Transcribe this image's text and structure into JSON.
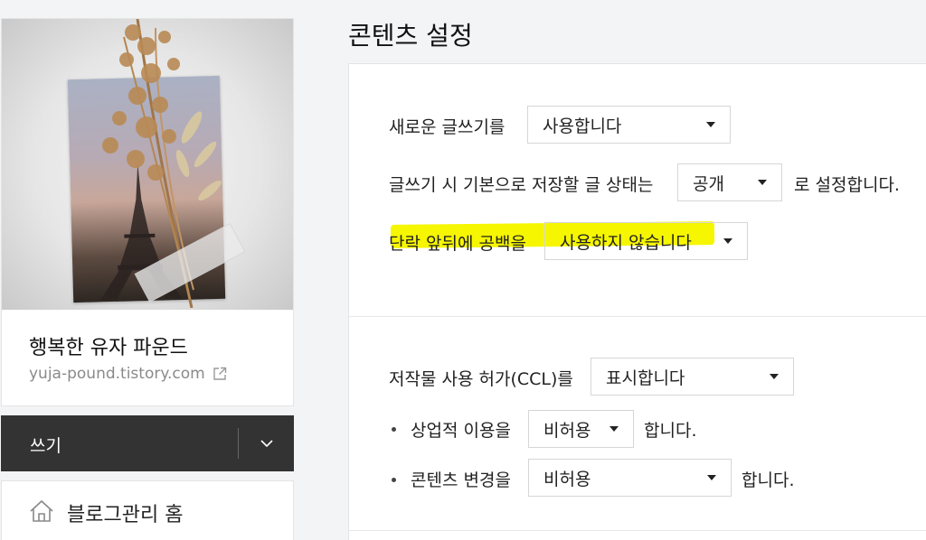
{
  "sidebar": {
    "blog_name": "행복한 유자 파운드",
    "blog_url": "yuja-pound.tistory.com",
    "write_label": "쓰기",
    "home_label": "블로그관리 홈"
  },
  "main": {
    "page_title": "콘텐츠 설정",
    "new_editor": {
      "label": "새로운 글쓰기를",
      "value": "사용합니다"
    },
    "default_status": {
      "label": "글쓰기 시 기본으로 저장할 글 상태는",
      "value": "공개",
      "suffix": "로 설정합니다."
    },
    "paragraph_spacing": {
      "label": "단락 앞뒤에 공백을",
      "value": "사용하지 않습니다"
    },
    "ccl": {
      "label": "저작물 사용 허가(CCL)를",
      "value": "표시합니다"
    },
    "commercial": {
      "label": "상업적 이용을",
      "value": "비허용",
      "suffix": "합니다."
    },
    "modification": {
      "label": "콘텐츠 변경을",
      "value": "비허용",
      "suffix": "합니다."
    }
  },
  "colors": {
    "write_bar": "#333333",
    "highlight": "#f6f600",
    "page_bg": "#f3f4f6"
  }
}
